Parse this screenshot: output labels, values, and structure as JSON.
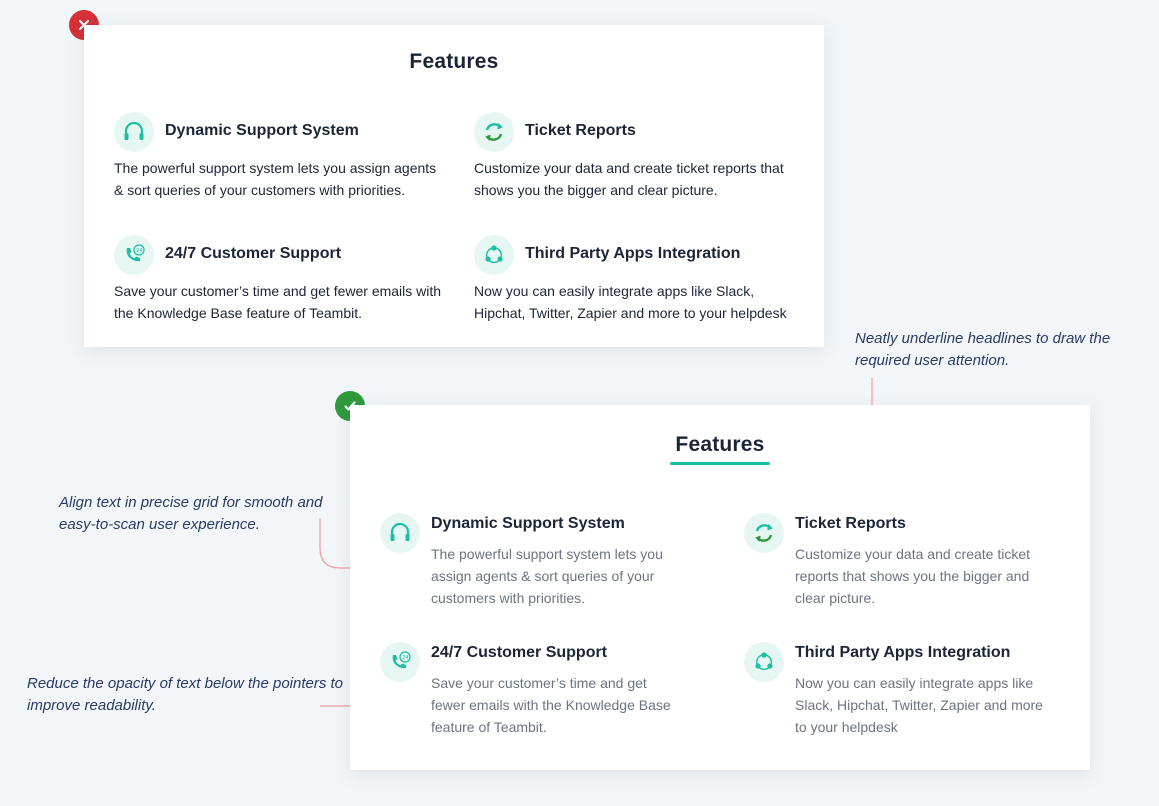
{
  "bad_example": {
    "title": "Features",
    "features": [
      {
        "title": "Dynamic Support System",
        "description": "The powerful support system lets you assign agents & sort queries of your customers with priorities.",
        "icon": "headset-icon"
      },
      {
        "title": "Ticket Reports",
        "description": "Customize your data and create ticket reports that shows you the bigger and clear picture.",
        "icon": "refresh-report-icon"
      },
      {
        "title": "24/7 Customer Support",
        "description": "Save your customer’s time and get fewer emails with the Knowledge Base feature of Teambit.",
        "icon": "phone-24-icon"
      },
      {
        "title": "Third Party Apps Integration",
        "description": "Now you can easily integrate apps like Slack, Hipchat, Twitter, Zapier and more to your helpdesk",
        "icon": "integration-nodes-icon"
      }
    ]
  },
  "good_example": {
    "title": "Features",
    "features": [
      {
        "title": "Dynamic Support System",
        "description": "The powerful support system lets you assign agents & sort queries of your customers with priorities.",
        "icon": "headset-icon"
      },
      {
        "title": "Ticket Reports",
        "description": "Customize your data and create ticket reports that shows you the bigger and clear picture.",
        "icon": "refresh-report-icon"
      },
      {
        "title": "24/7 Customer Support",
        "description": "Save your customer’s time and get fewer emails with the Knowledge Base feature of Teambit.",
        "icon": "phone-24-icon"
      },
      {
        "title": "Third Party Apps Integration",
        "description": "Now you can easily integrate apps like Slack, Hipchat, Twitter, Zapier and more to your helpdesk",
        "icon": "integration-nodes-icon"
      }
    ]
  },
  "annotations": {
    "underline": "Neatly underline headlines to draw the required user attention.",
    "grid": "Align text in precise grid for smooth and easy-to-scan user experience.",
    "opacity": "Reduce the opacity of text below the pointers to improve readability."
  },
  "badges": {
    "bad": "x-icon",
    "good": "check-icon"
  },
  "colors": {
    "accent": "#1bc0a2",
    "bad_badge": "#d63039",
    "good_badge": "#2f9a3c",
    "annotation_text": "#2a3a66",
    "connector_line": "#f29b9b"
  }
}
